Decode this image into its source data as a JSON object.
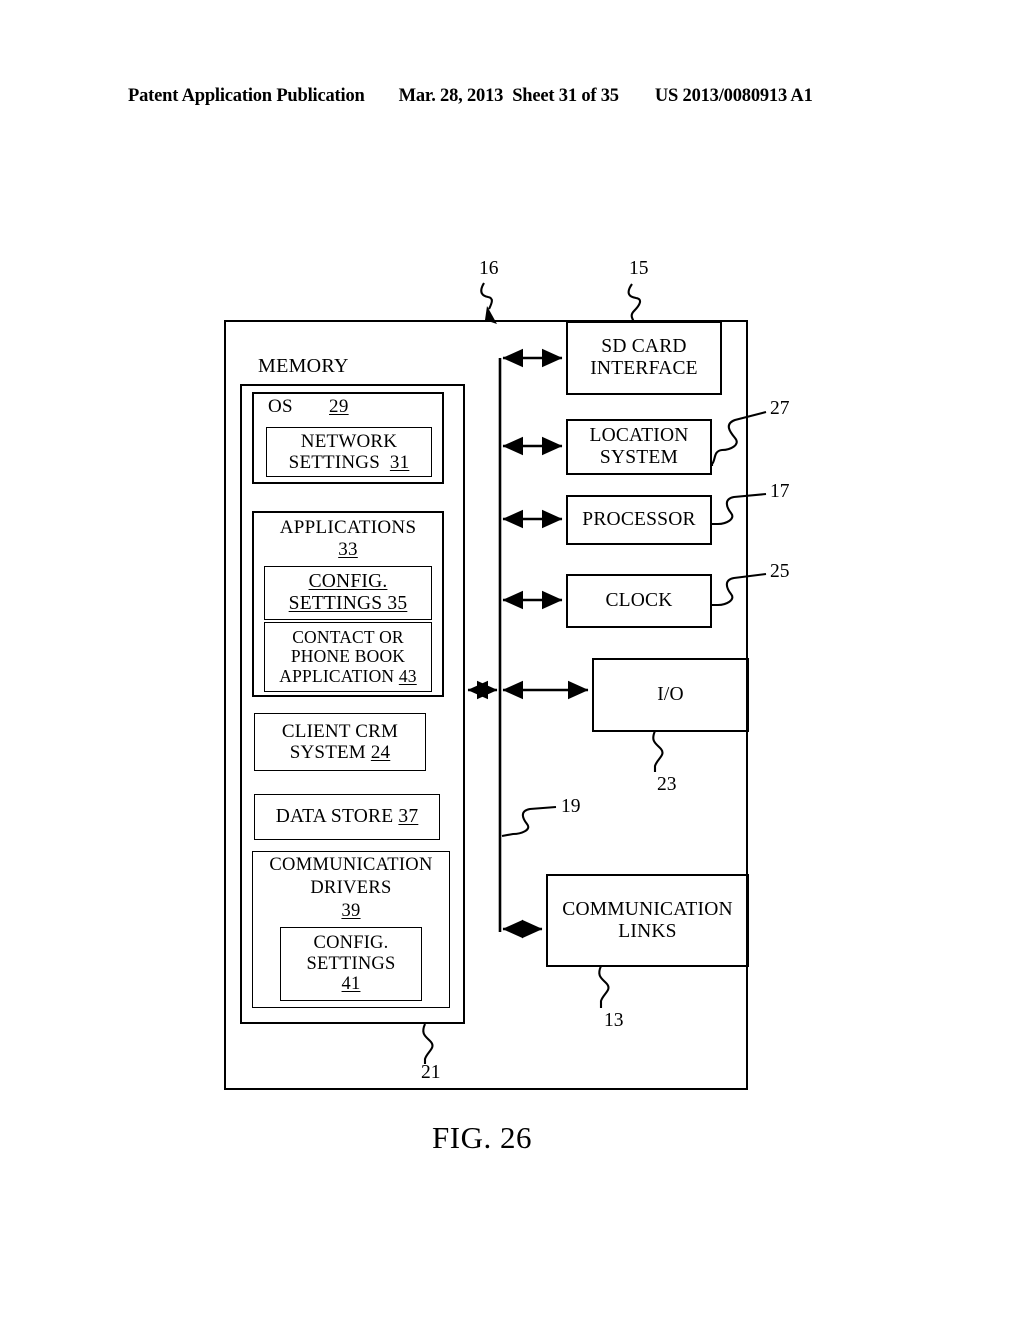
{
  "header": {
    "publication": "Patent Application Publication",
    "date": "Mar. 28, 2013",
    "sheet": "Sheet 31 of 35",
    "number": "US 2013/0080913 A1"
  },
  "figure": {
    "caption": "FIG. 26"
  },
  "diagram": {
    "memory": {
      "title": "MEMORY",
      "blocks": {
        "os": {
          "label": "OS",
          "ref": "29"
        },
        "network_settings": {
          "line1": "NETWORK",
          "line2": "SETTINGS",
          "ref": "31"
        },
        "applications": {
          "label": "APPLICATIONS",
          "ref": "33"
        },
        "config_settings_35": {
          "line1": "CONFIG.",
          "line2": "SETTINGS 35"
        },
        "contact_phone_book": {
          "line1": "CONTACT OR",
          "line2": "PHONE BOOK",
          "line3": "APPLICATION ",
          "ref": "43"
        },
        "client_crm": {
          "line1": "CLIENT CRM",
          "line2": "SYSTEM ",
          "ref": "24"
        },
        "data_store": {
          "label": "DATA STORE ",
          "ref": "37"
        },
        "communication_drivers": {
          "line1": "COMMUNICATION",
          "line2": "DRIVERS",
          "ref": "39"
        },
        "config_settings_41": {
          "line1": "CONFIG.",
          "line2": "SETTINGS",
          "ref": "41"
        }
      }
    },
    "peripherals": {
      "sd_card_interface": {
        "line1": "SD CARD",
        "line2": "INTERFACE"
      },
      "location_system": {
        "line1": "LOCATION",
        "line2": "SYSTEM"
      },
      "processor": {
        "label": "PROCESSOR"
      },
      "clock": {
        "label": "CLOCK"
      },
      "io": {
        "label": "I/O"
      },
      "communication_links": {
        "line1": "COMMUNICATION",
        "line2": "LINKS"
      }
    },
    "reference_numerals": {
      "device": "16",
      "sd_card_interface": "15",
      "location_system": "27",
      "processor": "17",
      "clock": "25",
      "io": "23",
      "bus": "19",
      "communication_links": "13",
      "memory": "21"
    }
  }
}
